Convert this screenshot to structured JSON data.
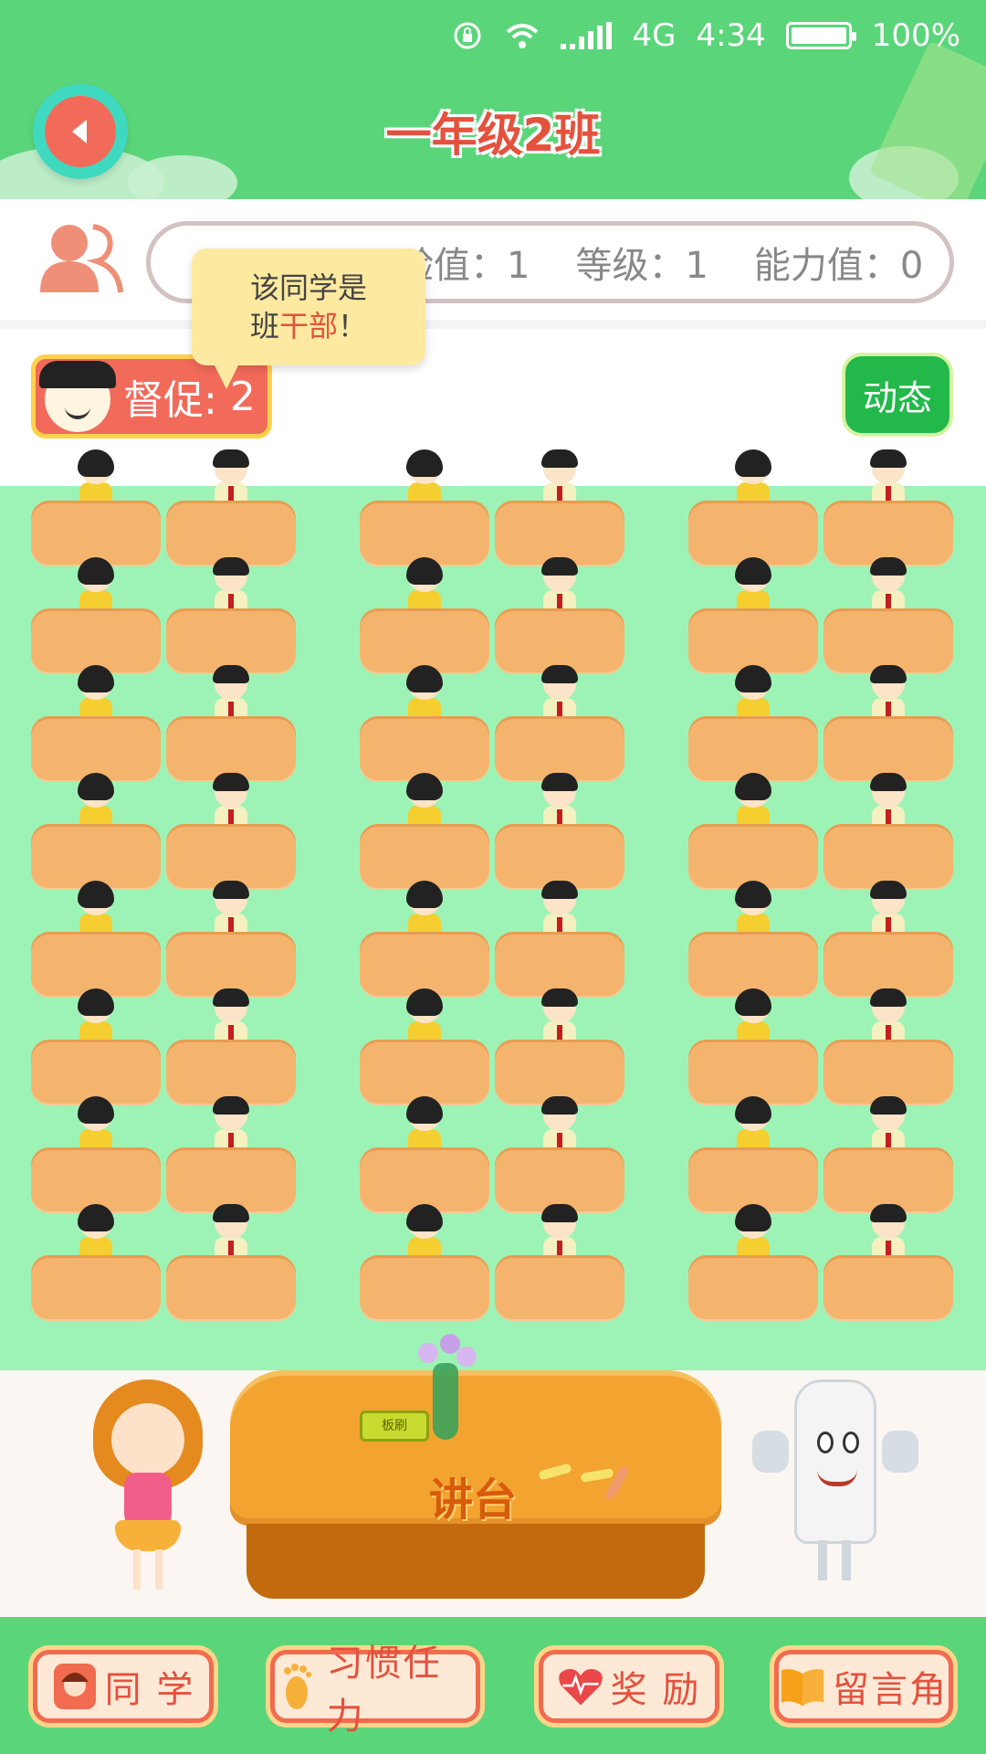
{
  "status_bar": {
    "network": "4G",
    "time": "4:34",
    "battery": "100%"
  },
  "header": {
    "title": "一年级2班"
  },
  "info": {
    "exp": "验值：1",
    "level": "等级：1",
    "ability": "能力值：0"
  },
  "tooltip": {
    "line1": "该同学是",
    "line2_prefix": "班",
    "line2_highlight": "干部",
    "line2_suffix": "！"
  },
  "actions": {
    "urge_label": "督促:",
    "urge_count": "2",
    "dynamic_label": "动态"
  },
  "podium": {
    "label": "讲台",
    "eraser": "板刷"
  },
  "bottom_nav": [
    {
      "label": "同 学",
      "icon": "student-icon"
    },
    {
      "label": "习惯任力",
      "icon": "footprint-icon"
    },
    {
      "label": "奖 励",
      "icon": "heart-icon"
    },
    {
      "label": "留言角",
      "icon": "book-icon"
    }
  ],
  "colors": {
    "header_green": "#5bd57a",
    "classroom_green": "#9df3b5",
    "desk_orange": "#f4b46e",
    "accent_red": "#f26b5a"
  }
}
